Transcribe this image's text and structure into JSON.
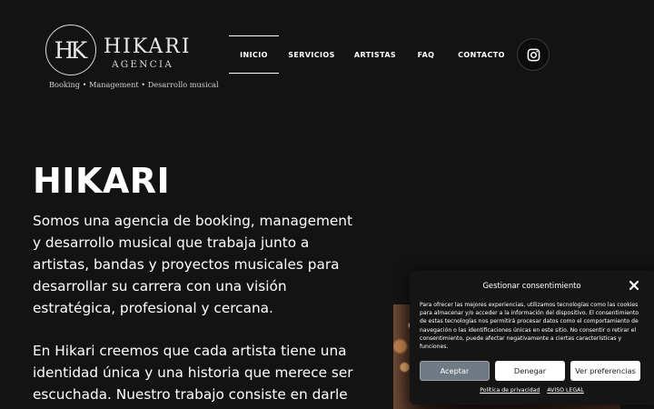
{
  "logo": {
    "monogram": "HK",
    "name": "HIKARI",
    "subtitle": "AGENCIA",
    "tagline": "Booking • Management • Desarrollo musical"
  },
  "nav": {
    "items": [
      {
        "label": "INICIO",
        "active": true
      },
      {
        "label": "SERVICIOS",
        "active": false
      },
      {
        "label": "ARTISTAS",
        "active": false
      },
      {
        "label": "FAQ",
        "active": false
      },
      {
        "label": "CONTACTO",
        "active": false
      }
    ],
    "social_icon": "instagram-icon"
  },
  "hero": {
    "title": "HIKARI",
    "paragraph1": "Somos una agencia de booking, management y desarrollo musical que trabaja junto a artistas, bandas y proyectos musicales para desarrollar su carrera con una visión estratégica, profesional y cercana.",
    "paragraph2": "En Hikari creemos que cada artista tiene una identidad única y una historia que merece ser escuchada. Nuestro trabajo consiste en darle"
  },
  "consent": {
    "title": "Gestionar consentimiento",
    "close_icon": "close-icon",
    "body": "Para ofrecer las mejores experiencias, utilizamos tecnologías como las cookies para almacenar y/o acceder a la información del dispositivo. El consentimiento de estas tecnologías nos permitirá procesar datos como el comportamiento de navegación o las identificaciones únicas en este sitio. No consentir o retirar el consentimiento, puede afectar negativamente a ciertas características y funciones.",
    "accept_label": "Aceptar",
    "deny_label": "Denegar",
    "preferences_label": "Ver preferencias",
    "privacy_link": "Política de privacidad",
    "legal_link": "AVISO LEGAL"
  },
  "colors": {
    "background": "#131313",
    "text": "#ffffff",
    "accept_button": "#6f7a84",
    "dialog_background": "#151515"
  }
}
